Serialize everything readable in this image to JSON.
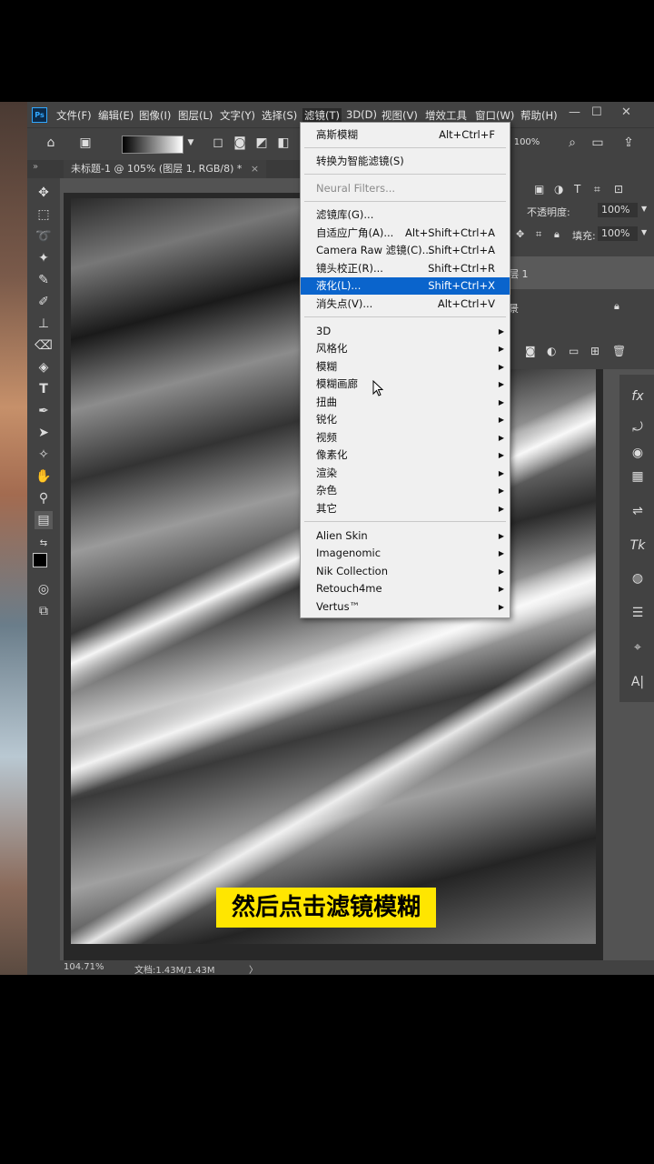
{
  "menubar": {
    "logo": "Ps",
    "items": [
      "文件(F)",
      "编辑(E)",
      "图像(I)",
      "图层(L)",
      "文字(Y)",
      "选择(S)",
      "滤镜(T)",
      "3D(D)",
      "视图(V)",
      "增效工具",
      "窗口(W)",
      "帮助(H)"
    ],
    "window_controls": [
      "—",
      "☐",
      "✕"
    ]
  },
  "options_bar": {
    "zoom_value": "100%"
  },
  "document_tab": {
    "title": "未标题-1 @ 105% (图层 1, RGB/8) *",
    "close": "×"
  },
  "layers_panel": {
    "opacity_label": "不透明度:",
    "opacity_value": "100%",
    "fill_label": "填充:",
    "fill_value": "100%",
    "layer1_name": "层 1",
    "background_name": "景"
  },
  "filter_menu": {
    "items": [
      {
        "label": "高斯模糊",
        "shortcut": "Alt+Ctrl+F"
      },
      {
        "label": "转换为智能滤镜(S)",
        "shortcut": ""
      },
      {
        "label": "Neural Filters...",
        "shortcut": "",
        "disabled": true
      },
      {
        "label": "滤镜库(G)...",
        "shortcut": ""
      },
      {
        "label": "自适应广角(A)...",
        "shortcut": "Alt+Shift+Ctrl+A"
      },
      {
        "label": "Camera Raw 滤镜(C)...",
        "shortcut": "Shift+Ctrl+A"
      },
      {
        "label": "镜头校正(R)...",
        "shortcut": "Shift+Ctrl+R"
      },
      {
        "label": "液化(L)...",
        "shortcut": "Shift+Ctrl+X",
        "highlighted": true
      },
      {
        "label": "消失点(V)...",
        "shortcut": "Alt+Ctrl+V"
      },
      {
        "label": "3D"
      },
      {
        "label": "风格化"
      },
      {
        "label": "模糊"
      },
      {
        "label": "模糊画廊"
      },
      {
        "label": "扭曲"
      },
      {
        "label": "锐化"
      },
      {
        "label": "视频"
      },
      {
        "label": "像素化"
      },
      {
        "label": "渲染"
      },
      {
        "label": "杂色"
      },
      {
        "label": "其它"
      },
      {
        "label": "Alien Skin"
      },
      {
        "label": "Imagenomic"
      },
      {
        "label": "Nik Collection"
      },
      {
        "label": "Retouch4me"
      },
      {
        "label": "Vertus™"
      }
    ]
  },
  "caption": "然后点击滤镜模糊",
  "statusbar": {
    "zoom": "104.71%",
    "doc_info": "文档:1.43M/1.43M",
    "arrow": "〉"
  },
  "colors": {
    "highlight": "#0a64cc",
    "caption_bg": "#ffe600",
    "ui_bg": "#535353"
  }
}
